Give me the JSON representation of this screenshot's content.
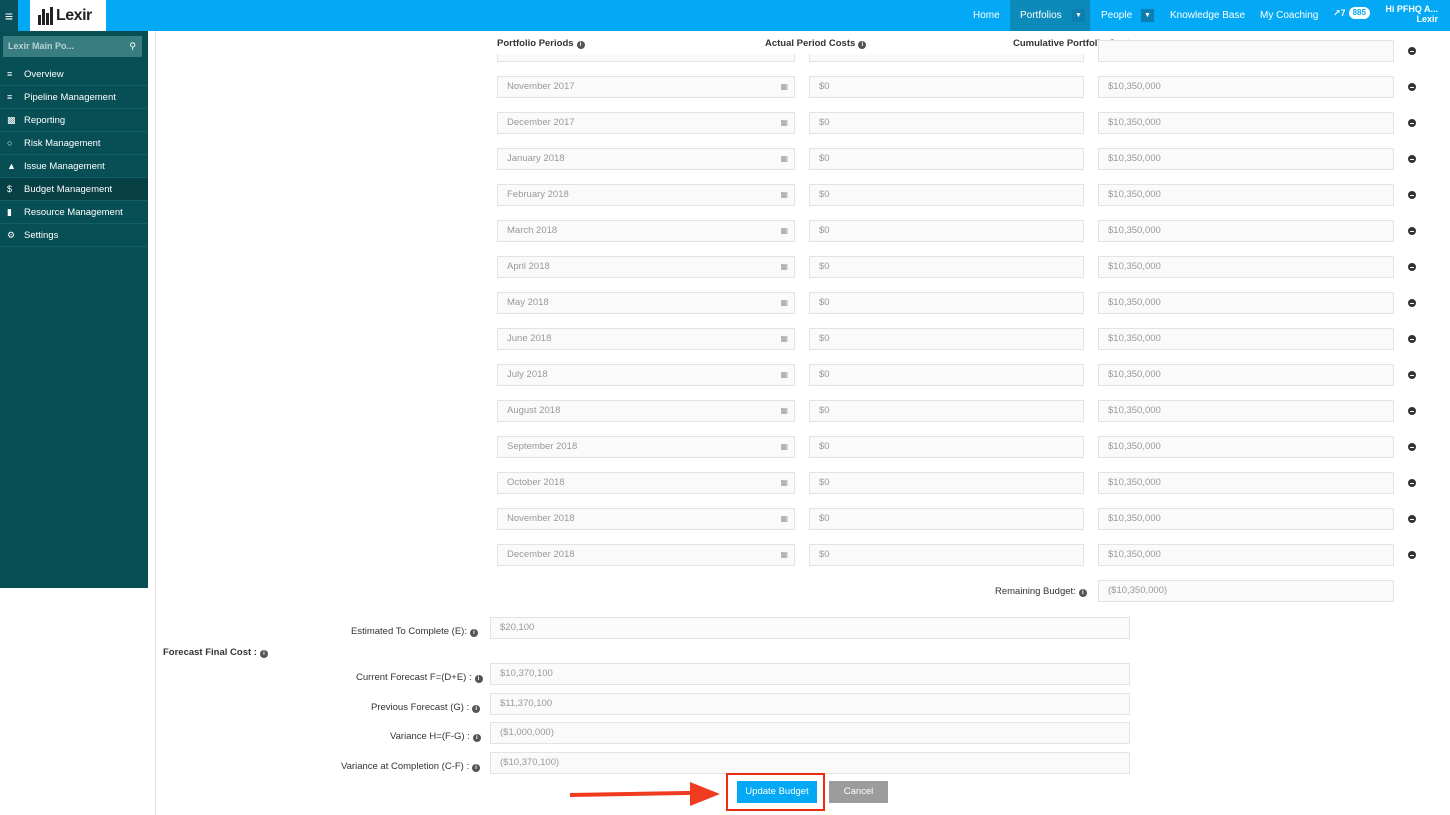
{
  "app": {
    "logo_text": "Lexir"
  },
  "topnav": {
    "home": "Home",
    "portfolios": "Portfolios",
    "people": "People",
    "knowledge_base": "Knowledge Base",
    "my_coaching": "My Coaching",
    "badge_count_1": "7",
    "badge_count_2": "885",
    "greeting_line1": "Hi PFHQ A...",
    "greeting_line2": "Lexir"
  },
  "sidebar": {
    "search_value": "Lexir Main Po...",
    "items": [
      {
        "label": "Overview",
        "icon": "list-icon"
      },
      {
        "label": "Pipeline Management",
        "icon": "list-icon"
      },
      {
        "label": "Reporting",
        "icon": "bar-chart-icon"
      },
      {
        "label": "Risk Management",
        "icon": "bulb-icon"
      },
      {
        "label": "Issue Management",
        "icon": "warning-icon"
      },
      {
        "label": "Budget Management",
        "icon": "dollar-icon"
      },
      {
        "label": "Resource Management",
        "icon": "folder-icon"
      },
      {
        "label": "Settings",
        "icon": "gears-icon"
      }
    ],
    "active_item": "Budget Management"
  },
  "table": {
    "headers": {
      "period": "Portfolio Periods",
      "actual": "Actual Period Costs",
      "cumulative": "Cumulative Portfolio Costs"
    },
    "rows": [
      {
        "period": "November 2017",
        "actual": "$0",
        "cumulative": "$10,350,000"
      },
      {
        "period": "December 2017",
        "actual": "$0",
        "cumulative": "$10,350,000"
      },
      {
        "period": "January 2018",
        "actual": "$0",
        "cumulative": "$10,350,000"
      },
      {
        "period": "February 2018",
        "actual": "$0",
        "cumulative": "$10,350,000"
      },
      {
        "period": "March 2018",
        "actual": "$0",
        "cumulative": "$10,350,000"
      },
      {
        "period": "April 2018",
        "actual": "$0",
        "cumulative": "$10,350,000"
      },
      {
        "period": "May 2018",
        "actual": "$0",
        "cumulative": "$10,350,000"
      },
      {
        "period": "June 2018",
        "actual": "$0",
        "cumulative": "$10,350,000"
      },
      {
        "period": "July 2018",
        "actual": "$0",
        "cumulative": "$10,350,000"
      },
      {
        "period": "August 2018",
        "actual": "$0",
        "cumulative": "$10,350,000"
      },
      {
        "period": "September 2018",
        "actual": "$0",
        "cumulative": "$10,350,000"
      },
      {
        "period": "October 2018",
        "actual": "$0",
        "cumulative": "$10,350,000"
      },
      {
        "period": "November 2018",
        "actual": "$0",
        "cumulative": "$10,350,000"
      },
      {
        "period": "December 2018",
        "actual": "$0",
        "cumulative": "$10,350,000"
      }
    ],
    "remaining_label": "Remaining Budget:",
    "remaining_value": "($10,350,000)"
  },
  "forecast": {
    "etc_label": "Estimated To Complete (E):",
    "etc_value": "$20,100",
    "section_label": "Forecast Final Cost :",
    "current_label": "Current Forecast F=(D+E) :",
    "current_value": "$10,370,100",
    "previous_label": "Previous Forecast (G) :",
    "previous_value": "$11,370,100",
    "variance_label": "Variance H=(F-G) :",
    "variance_value": "($1,000,000)",
    "vac_label": "Variance at Completion (C-F) :",
    "vac_value": "($10,370,100)"
  },
  "actions": {
    "update_label": "Update Budget",
    "cancel_label": "Cancel"
  },
  "colors": {
    "topbar": "#03a9f4",
    "sidebar": "#074f55",
    "annotation": "#ef2a14"
  }
}
